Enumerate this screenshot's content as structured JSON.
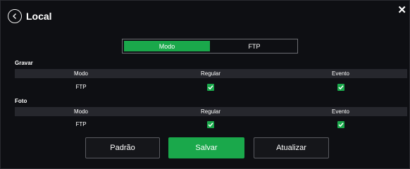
{
  "header": {
    "title": "Local",
    "back_icon": "circle-chevron-left-icon",
    "close_icon": "close-icon"
  },
  "tabs": [
    {
      "label": "Modo",
      "active": true
    },
    {
      "label": "FTP",
      "active": false
    }
  ],
  "gravar": {
    "label": "Gravar",
    "columns": [
      "Modo",
      "Regular",
      "Evento"
    ],
    "rows": [
      {
        "modo": "FTP",
        "regular": true,
        "evento": true
      }
    ]
  },
  "foto": {
    "label": "Foto",
    "columns": [
      "Modo",
      "Regular",
      "Evento"
    ],
    "rows": [
      {
        "modo": "FTP",
        "regular": true,
        "evento": true
      }
    ]
  },
  "buttons": {
    "default": "Padrão",
    "save": "Salvar",
    "refresh": "Atualizar"
  },
  "colors": {
    "accent": "#1aa84b",
    "background": "#0e0f13",
    "table_header": "#26272d"
  }
}
